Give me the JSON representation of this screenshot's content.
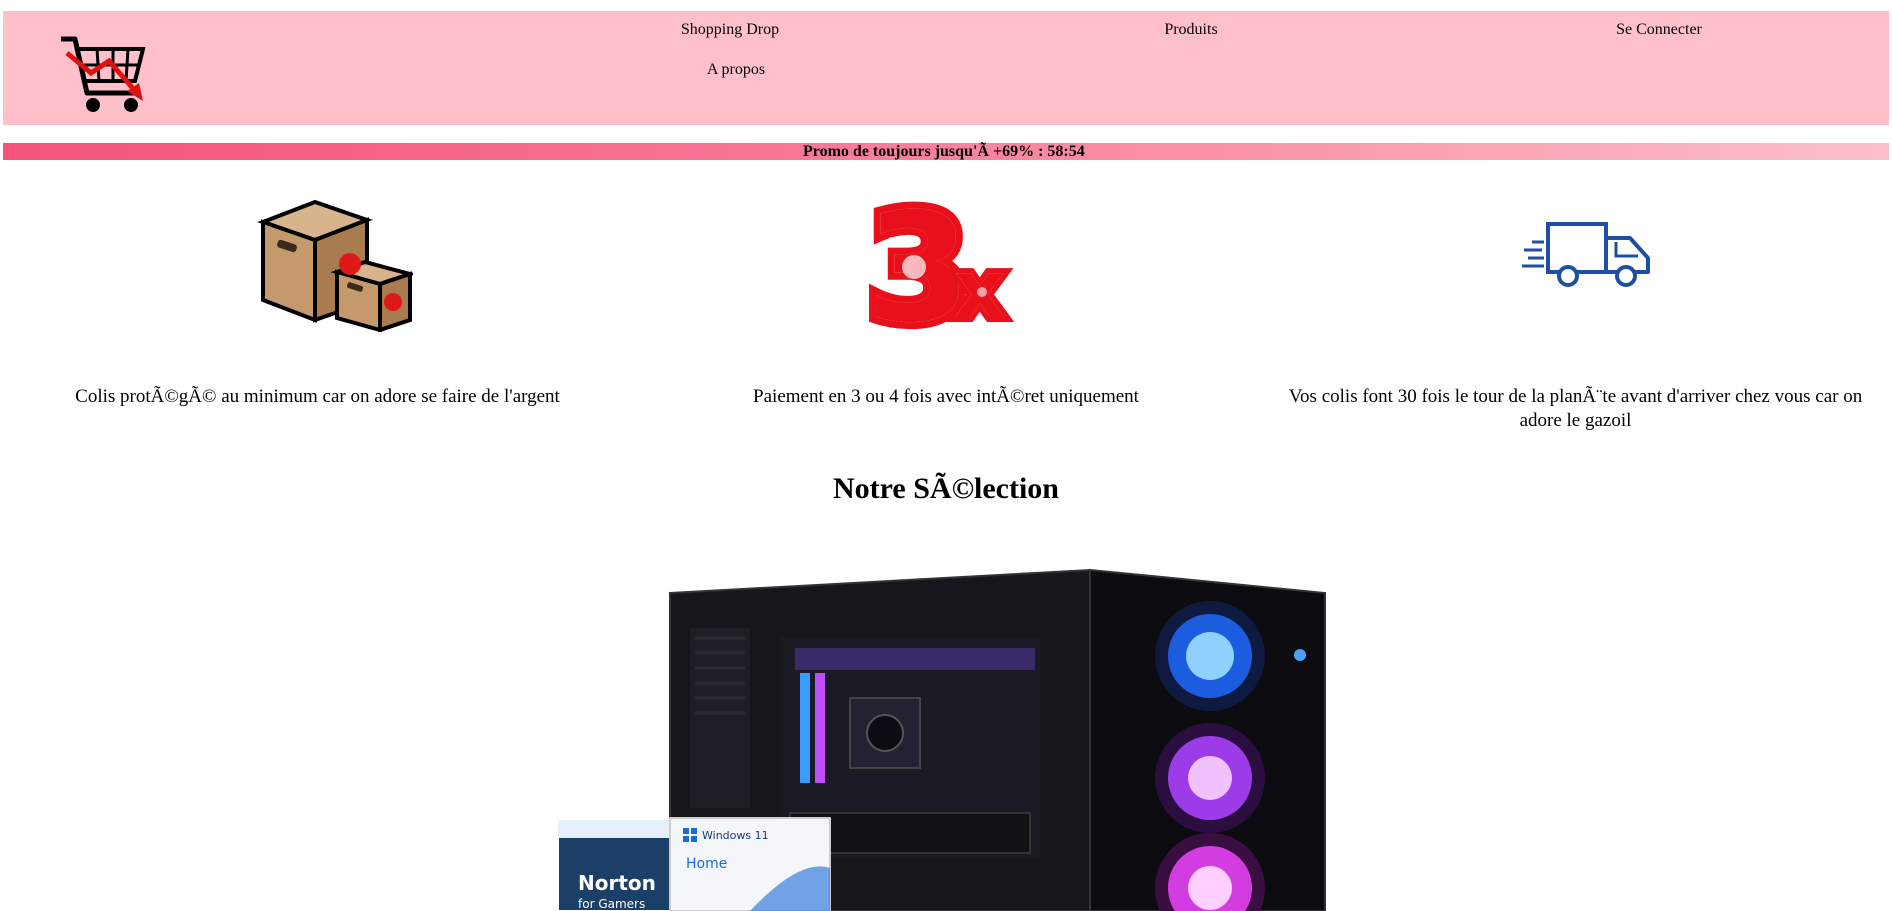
{
  "header": {
    "logo_icon": "shopping-cart-down-arrow-icon",
    "nav": {
      "shopping_drop": "Shopping Drop",
      "produits": "Produits",
      "se_connecter": "Se Connecter",
      "a_propos": "A propos"
    }
  },
  "promo": {
    "text": "Promo de toujours jusqu'Ã  +69% : 58:54"
  },
  "features": [
    {
      "icon": "cardboard-boxes-icon",
      "text": "Colis protÃ©gÃ© au minimum car on adore se faire de l'argent"
    },
    {
      "icon": "3x-payment-icon",
      "icon_text": "3x",
      "text": "Paiement en 3 ou 4 fois avec intÃ©ret uniquement"
    },
    {
      "icon": "delivery-truck-icon",
      "text": "Vos colis font 30 fois le tour de la planÃ¨te avant d'arriver chez vous car on adore le gazoil"
    }
  ],
  "selection": {
    "title": "Notre SÃ©lection",
    "product_image": "gaming-pc-tower-image",
    "box1_brand": "Norton",
    "box1_sub": "for Gamers",
    "box2_brand": "Windows 11",
    "box2_edition": "Home"
  },
  "colors": {
    "header_bg": "#ffc0cb",
    "promo_start": "#f45379",
    "promo_end": "#f9c0cb",
    "truck_blue": "#1f4fa3",
    "three_x_red": "#e8101a"
  }
}
